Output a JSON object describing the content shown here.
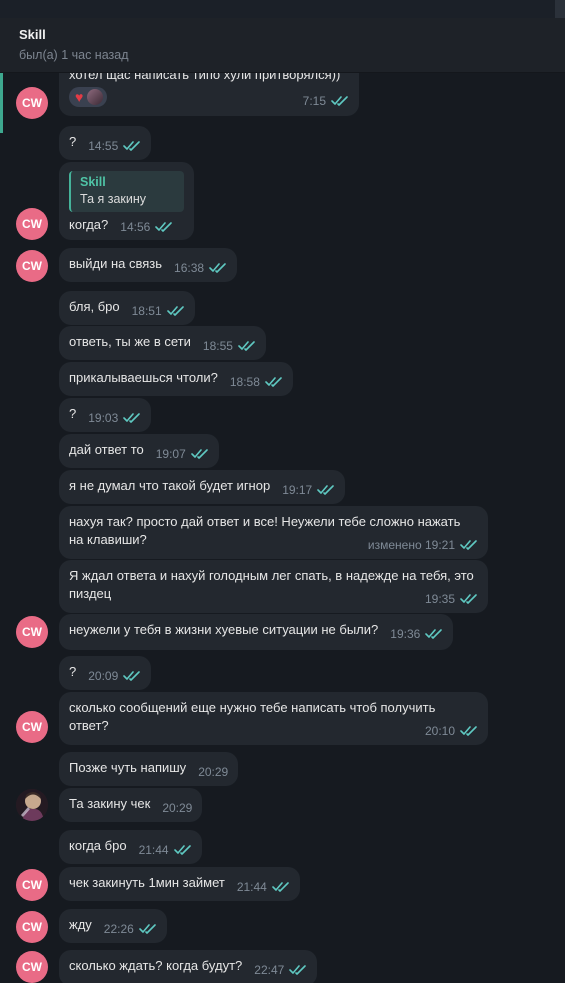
{
  "header": {
    "name": "Skill",
    "status": "был(а) 1 час назад"
  },
  "avatar": {
    "initials": "CW",
    "color": "#e96b86"
  },
  "colors": {
    "accent": "#3ea88f",
    "bubble": "#23282f",
    "check": "#5fc9c2"
  },
  "messages": [
    {
      "text": "хотел щас написать типо хули притворялся))",
      "time": "7:15",
      "reactions": [
        "heart",
        "user-avatar"
      ]
    },
    {
      "text": "?",
      "time": "14:55"
    },
    {
      "reply_name": "Skill",
      "reply_text": "Та я закину",
      "text": "когда?",
      "time": "14:56"
    },
    {
      "text": "выйди на связь",
      "time": "16:38"
    },
    {
      "text": "бля, бро",
      "time": "18:51"
    },
    {
      "text": "ответь, ты же в сети",
      "time": "18:55"
    },
    {
      "text": "прикалываешься чтоли?",
      "time": "18:58"
    },
    {
      "text": "?",
      "time": "19:03"
    },
    {
      "text": "дай ответ то",
      "time": "19:07"
    },
    {
      "text": "я не думал что такой будет игнор",
      "time": "19:17"
    },
    {
      "text": "нахуя так? просто дай ответ и все! Неужели тебе сложно нажать на клавиши?",
      "time": "изменено 19:21"
    },
    {
      "text": "Я ждал ответа и нахуй голодным лег спать, в надежде на тебя, это пиздец",
      "time": "19:35"
    },
    {
      "text": "неужели у тебя в жизни хуевые ситуации не были?",
      "time": "19:36"
    },
    {
      "text": "?",
      "time": "20:09"
    },
    {
      "text": "сколько сообщений еще нужно тебе написать чтоб получить ответ?",
      "time": "20:10"
    },
    {
      "text": "Позже чуть напишу",
      "time": "20:29"
    },
    {
      "text": "Та закину чек",
      "time": "20:29"
    },
    {
      "text": "когда бро",
      "time": "21:44"
    },
    {
      "text": "чек закинуть 1мин займет",
      "time": "21:44"
    },
    {
      "text": "жду",
      "time": "22:26"
    },
    {
      "text": "сколько ждать? когда будут?",
      "time": "22:47"
    }
  ]
}
